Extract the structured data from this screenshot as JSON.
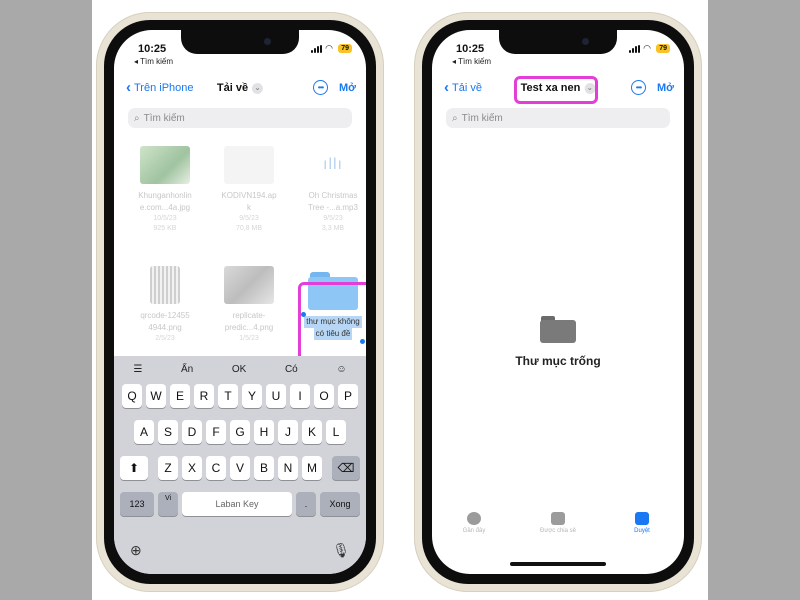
{
  "left_phone": {
    "status": {
      "time": "10:25",
      "back_app": "◂ Tìm kiếm",
      "battery": "79"
    },
    "nav": {
      "back_label": "Trên iPhone",
      "title": "Tải về",
      "done_label": "Mở"
    },
    "search": {
      "placeholder": "Tìm kiếm"
    },
    "files": [
      {
        "name_line1": "Khunganhonlin",
        "name_line2": "e.com...4a.jpg",
        "meta1": "10/5/23",
        "meta2": "925 KB"
      },
      {
        "name_line1": "KODIVN194.ap",
        "name_line2": "k",
        "meta1": "9/5/23",
        "meta2": "70,8 MB"
      },
      {
        "name_line1": "Oh Christmas",
        "name_line2": "Tree -...a.mp3",
        "meta1": "9/5/23",
        "meta2": "3,3 MB"
      },
      {
        "name_line1": "qrcode-12455",
        "name_line2": "4944.png",
        "meta1": "2/5/23",
        "meta2": ""
      },
      {
        "name_line1": "replicate-",
        "name_line2": "predic...4.png",
        "meta1": "1/5/23",
        "meta2": ""
      }
    ],
    "new_folder": {
      "line1": "thư mục không",
      "line2": "có tiêu đề"
    },
    "keyboard": {
      "suggestions": [
        "Ẩn",
        "OK",
        "Có"
      ],
      "row1": [
        "Q",
        "W",
        "E",
        "R",
        "T",
        "Y",
        "U",
        "I",
        "O",
        "P"
      ],
      "row2": [
        "A",
        "S",
        "D",
        "F",
        "G",
        "H",
        "J",
        "K",
        "L"
      ],
      "row3": [
        "Z",
        "X",
        "C",
        "V",
        "B",
        "N",
        "M"
      ],
      "numbers_key": "123",
      "vi_key": "Vi",
      "space_label": "Laban Key",
      "period_key": ".",
      "done_key": "Xong"
    }
  },
  "right_phone": {
    "status": {
      "time": "10:25",
      "back_app": "◂ Tìm kiếm",
      "battery": "79"
    },
    "nav": {
      "back_label": "Tải về",
      "title": "Test xa nen",
      "done_label": "Mở"
    },
    "search": {
      "placeholder": "Tìm kiếm"
    },
    "empty_message": "Thư mục trống",
    "tabs": [
      {
        "label": "Gần đây",
        "icon": "clock-icon",
        "active": false
      },
      {
        "label": "Được chia sẻ",
        "icon": "shared-folder-icon",
        "active": false
      },
      {
        "label": "Duyệt",
        "icon": "folder-icon",
        "active": true
      }
    ]
  },
  "colors": {
    "accent": "#1978f2",
    "highlight": "#e33fd8",
    "folder_blue": "#8ec7f5",
    "keyboard_bg": "#d1d3d9",
    "side_gray": "#a9a9a9"
  }
}
